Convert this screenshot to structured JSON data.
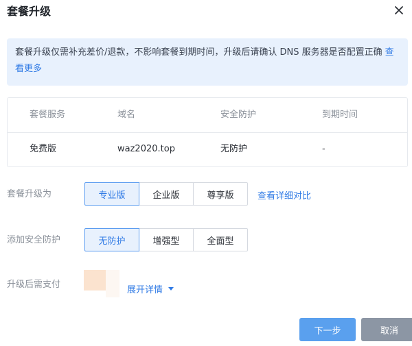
{
  "dialog": {
    "title": "套餐升级"
  },
  "notice": {
    "text": "套餐升级仅需补充差价/退款，不影响套餐到期时间，升级后请确认 DNS 服务器是否配置正确",
    "link": "查看更多"
  },
  "table": {
    "headers": [
      "套餐服务",
      "域名",
      "安全防护",
      "到期时间"
    ],
    "rows": [
      [
        "免费版",
        "waz2020.top",
        "无防护",
        "-"
      ]
    ]
  },
  "upgrade": {
    "label": "套餐升级为",
    "options": [
      "专业版",
      "企业版",
      "尊享版"
    ],
    "selected": "专业版",
    "compare_link": "查看详细对比"
  },
  "protection": {
    "label": "添加安全防护",
    "options": [
      "无防护",
      "增强型",
      "全面型"
    ],
    "selected": "无防护"
  },
  "payment": {
    "label": "升级后需支付",
    "expand_link": "展开详情"
  },
  "footer": {
    "next_label": "下一步",
    "cancel_label": "取消"
  },
  "colors": {
    "accent": "#2f7ae5",
    "primary_button": "#5aa0ee",
    "cancel_button": "#8c96a4",
    "notice_bg": "#e8f1fd"
  }
}
